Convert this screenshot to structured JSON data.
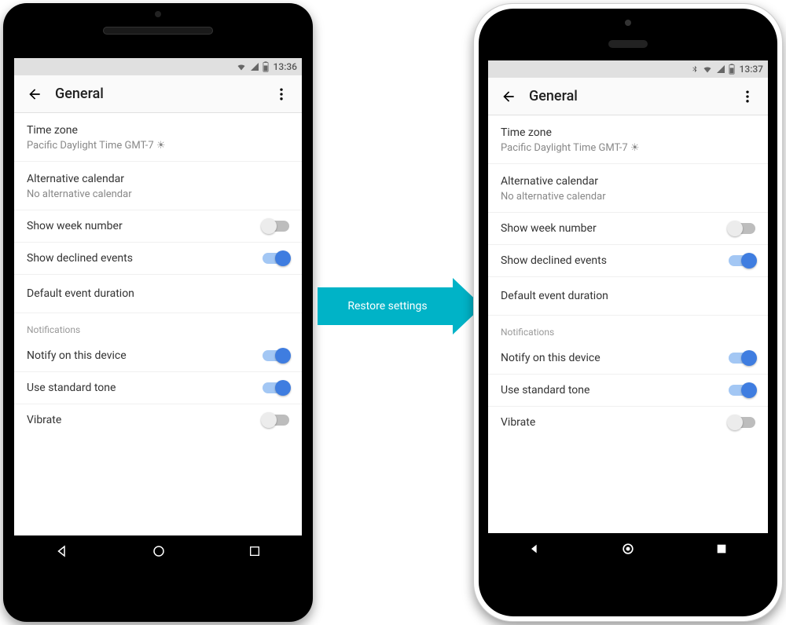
{
  "arrow": {
    "label": "Restore settings"
  },
  "phones": [
    {
      "status": {
        "time": "13:36",
        "bluetooth": false
      },
      "appbar": {
        "title": "General"
      },
      "settings": {
        "timezone": {
          "title": "Time zone",
          "value": "Pacific Daylight Time  GMT-7 ☀"
        },
        "altcal": {
          "title": "Alternative calendar",
          "value": "No alternative calendar"
        },
        "weeknum": {
          "title": "Show week number",
          "on": false
        },
        "declined": {
          "title": "Show declined events",
          "on": true
        },
        "defdur": {
          "title": "Default event duration"
        },
        "notifHeader": "Notifications",
        "notify": {
          "title": "Notify on this device",
          "on": true
        },
        "stdtone": {
          "title": "Use standard tone",
          "on": true
        },
        "vibrate": {
          "title": "Vibrate",
          "on": false
        }
      }
    },
    {
      "status": {
        "time": "13:37",
        "bluetooth": true
      },
      "appbar": {
        "title": "General"
      },
      "settings": {
        "timezone": {
          "title": "Time zone",
          "value": "Pacific Daylight Time  GMT-7 ☀"
        },
        "altcal": {
          "title": "Alternative calendar",
          "value": "No alternative calendar"
        },
        "weeknum": {
          "title": "Show week number",
          "on": false
        },
        "declined": {
          "title": "Show declined events",
          "on": true
        },
        "defdur": {
          "title": "Default event duration"
        },
        "notifHeader": "Notifications",
        "notify": {
          "title": "Notify on this device",
          "on": true
        },
        "stdtone": {
          "title": "Use standard tone",
          "on": true
        },
        "vibrate": {
          "title": "Vibrate",
          "on": false
        }
      }
    }
  ]
}
